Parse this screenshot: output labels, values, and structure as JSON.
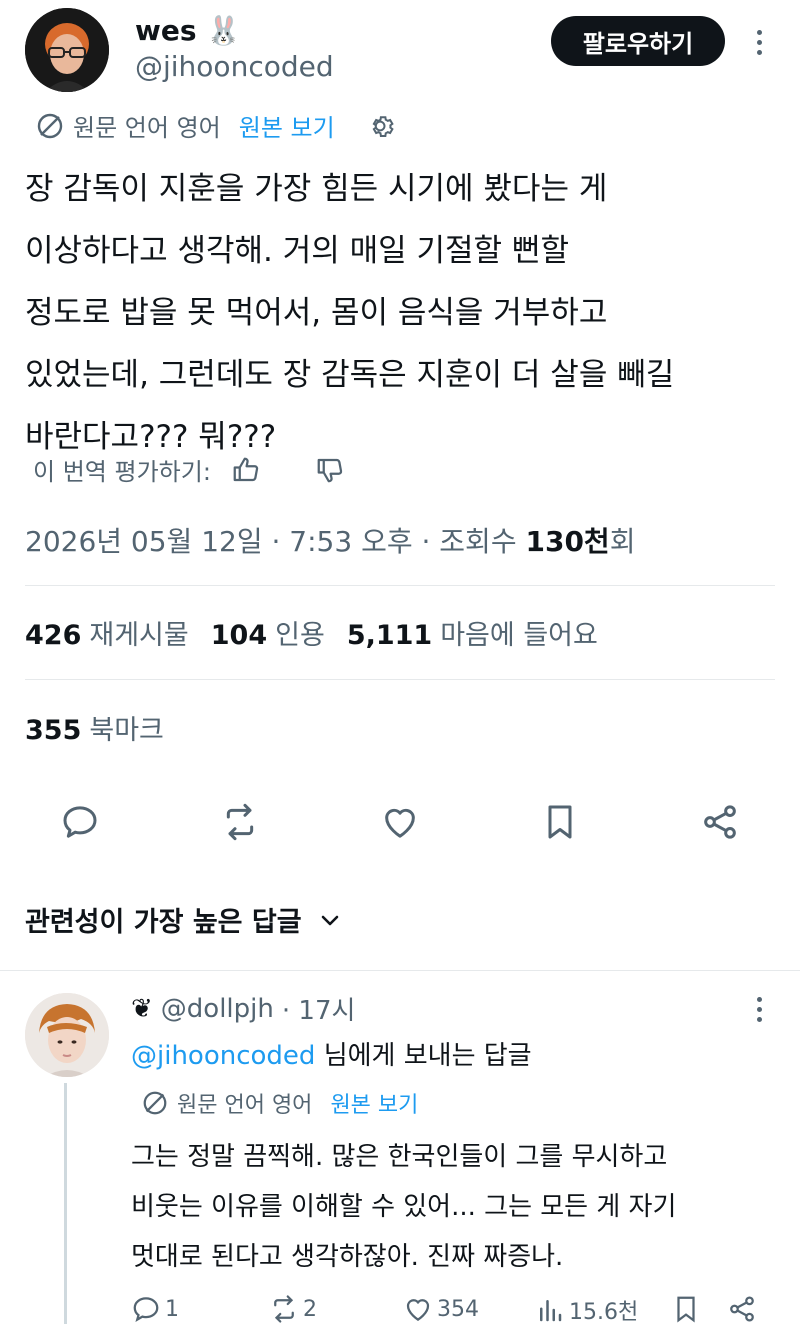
{
  "tweet": {
    "author_name": "wes",
    "author_emoji": "🐰",
    "author_handle": "@jihooncoded",
    "follow_label": "팔로우하기",
    "translation_note": "원문 언어 영어",
    "show_original_label": "원본 보기",
    "body": "장 감독이 지훈을 가장 힘든 시기에 봤다는 게\n이상하다고 생각해. 거의 매일 기절할 뻔할\n정도로 밥을 못 먹어서, 몸이 음식을 거부하고\n있었는데, 그런데도 장 감독은 지훈이 더 살을 빼길\n바란다고??? 뭐???",
    "rate_translation_label": "이 번역 평가하기:",
    "timestamp": "2026년 05월 12일 · 7:53 오후 · 조회수 ",
    "views_number": "130천",
    "views_suffix": "회",
    "stats": {
      "reposts_count": "426",
      "reposts_label": "재게시물",
      "quotes_count": "104",
      "quotes_label": "인용",
      "likes_count": "5,111",
      "likes_label": "마음에 들어요",
      "bookmarks_count": "355",
      "bookmarks_label": "북마크"
    },
    "action_icons": [
      "reply-icon",
      "repost-icon",
      "like-icon",
      "bookmark-icon",
      "share-icon"
    ]
  },
  "replies_sort_label": "관련성이 가장 높은 답글",
  "reply": {
    "author_emoji": "❦",
    "handle": "@dollpjh",
    "time": "· 17시",
    "replying_to_handle": "@jihooncoded",
    "replying_to_suffix": " 님에게 보내는 답글",
    "translation_note": "원문 언어 영어",
    "show_original_label": "원본 보기",
    "body": "그는 정말 끔찍해. 많은 한국인들이 그를 무시하고\n비웃는 이유를 이해할 수 있어... 그는 모든 게 자기\n멋대로 된다고 생각하잖아. 진짜 짜증나.",
    "replies": "1",
    "reposts": "2",
    "likes": "354",
    "views": "15.6천"
  },
  "colors": {
    "text": "#0f1419",
    "muted": "#536471",
    "accent": "#1d9bf0",
    "divider": "#e6e9eb"
  }
}
